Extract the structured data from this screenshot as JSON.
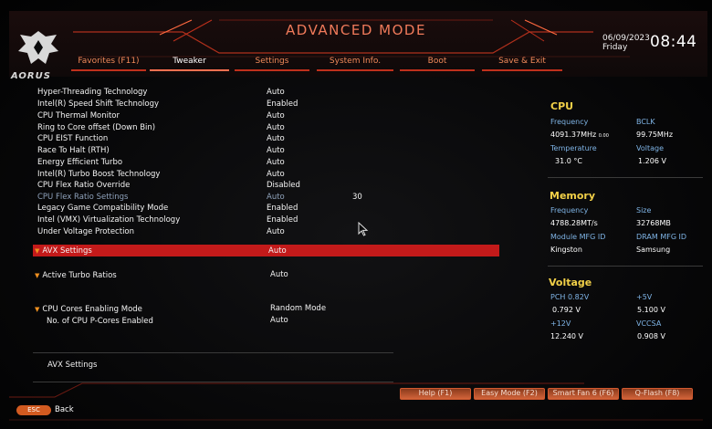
{
  "header": {
    "logo_text": "AORUS",
    "title": "ADVANCED MODE",
    "date": "06/09/2023",
    "day": "Friday",
    "time": "08:44"
  },
  "tabs": [
    {
      "label": "Favorites (F11)"
    },
    {
      "label": "Tweaker"
    },
    {
      "label": "Settings"
    },
    {
      "label": "System Info."
    },
    {
      "label": "Boot"
    },
    {
      "label": "Save & Exit"
    }
  ],
  "settings": [
    {
      "label": "Hyper-Threading Technology",
      "value": "Auto"
    },
    {
      "label": "Intel(R) Speed Shift Technology",
      "value": "Enabled"
    },
    {
      "label": "CPU Thermal Monitor",
      "value": "Auto"
    },
    {
      "label": "Ring to Core offset (Down Bin)",
      "value": "Auto"
    },
    {
      "label": "CPU EIST Function",
      "value": "Auto"
    },
    {
      "label": "Race To Halt (RTH)",
      "value": "Auto"
    },
    {
      "label": "Energy Efficient Turbo",
      "value": "Auto"
    },
    {
      "label": "Intel(R) Turbo Boost Technology",
      "value": "Auto"
    },
    {
      "label": "CPU Flex Ratio Override",
      "value": "Disabled"
    },
    {
      "label": "CPU Flex Ratio Settings",
      "value": "Auto",
      "extra": "30"
    },
    {
      "label": "Legacy Game Compatibility Mode",
      "value": "Enabled"
    },
    {
      "label": "Intel (VMX) Virtualization Technology",
      "value": "Enabled"
    },
    {
      "label": "Under Voltage Protection",
      "value": "Auto"
    }
  ],
  "avx": {
    "label": "AVX Settings",
    "value": "Auto"
  },
  "turbo": {
    "label": "Active Turbo Ratios",
    "value": "Auto"
  },
  "cores": {
    "label": "CPU Cores Enabling Mode",
    "value": "Random Mode"
  },
  "pcores": {
    "label": "No. of CPU P-Cores Enabled",
    "value": "Auto"
  },
  "help_text": "AVX Settings",
  "panel": {
    "cpu": {
      "title": "CPU",
      "freq_label": "Frequency",
      "freq_value": "4091.37MHz",
      "freq_suffix": "0.00",
      "bclk_label": "BCLK",
      "bclk_value": "99.75MHz",
      "temp_label": "Temperature",
      "temp_value": "31.0 °C",
      "volt_label": "Voltage",
      "volt_value": "1.206 V"
    },
    "memory": {
      "title": "Memory",
      "freq_label": "Frequency",
      "freq_value": "4788.28MT/s",
      "size_label": "Size",
      "size_value": "32768MB",
      "mfg_label": "Module MFG ID",
      "mfg_value": "Kingston",
      "dram_label": "DRAM MFG ID",
      "dram_value": "Samsung"
    },
    "voltage": {
      "title": "Voltage",
      "pch_label": "PCH 0.82V",
      "pch_value": "0.792 V",
      "p5_label": "+5V",
      "p5_value": "5.100 V",
      "p12_label": "+12V",
      "p12_value": "12.240 V",
      "vccsa_label": "VCCSA",
      "vccsa_value": "0.908 V"
    }
  },
  "footer": {
    "help": "Help (F1)",
    "easy": "Easy Mode (F2)",
    "fan": "Smart Fan 6 (F6)",
    "qflash": "Q-Flash (F8)",
    "esc": "ESC",
    "back": "Back"
  },
  "colors": {
    "accent": "#c31a1a",
    "orange": "#f08a5a",
    "heading": "#f2d048",
    "label": "#7fb4e6"
  }
}
